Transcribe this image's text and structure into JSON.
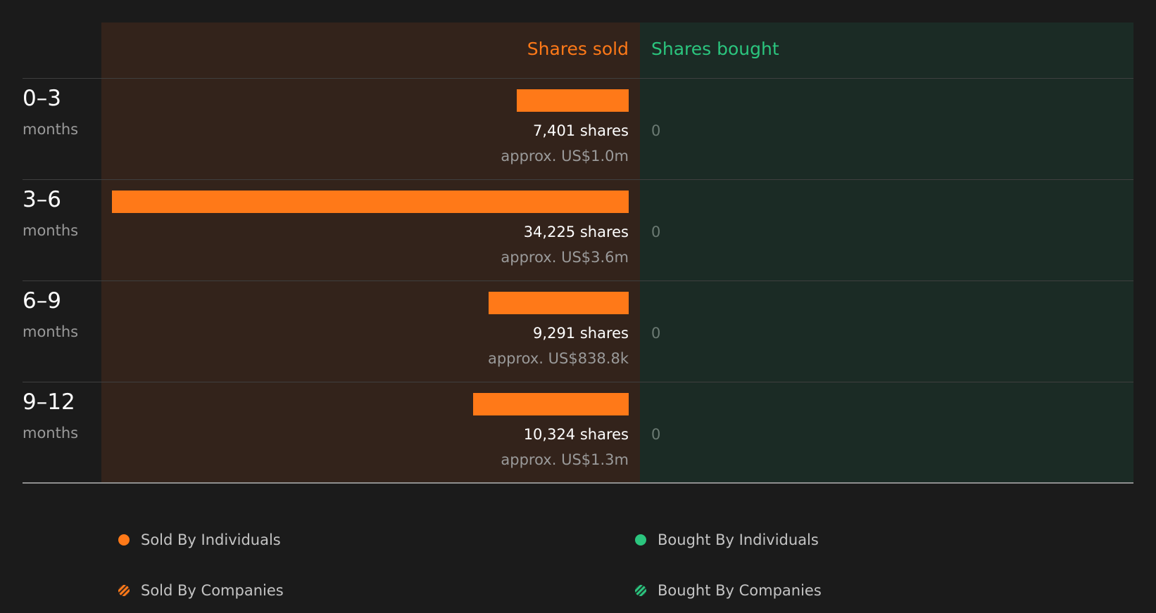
{
  "chart_data": {
    "type": "bar",
    "columns": {
      "sold": "Shares sold",
      "bought": "Shares bought"
    },
    "categories": [
      {
        "label": "0–3",
        "unit": "months"
      },
      {
        "label": "3–6",
        "unit": "months"
      },
      {
        "label": "6–9",
        "unit": "months"
      },
      {
        "label": "9–12",
        "unit": "months"
      }
    ],
    "series": [
      {
        "name": "Shares sold",
        "values": [
          7401,
          34225,
          9291,
          10324
        ],
        "value_labels": [
          "7,401 shares",
          "34,225 shares",
          "9,291 shares",
          "10,324 shares"
        ],
        "usd_labels": [
          "approx. US$1.0m",
          "approx. US$3.6m",
          "approx. US$838.8k",
          "approx. US$1.3m"
        ]
      },
      {
        "name": "Shares bought",
        "values": [
          0,
          0,
          0,
          0
        ],
        "value_labels": [
          "0",
          "0",
          "0",
          "0"
        ]
      }
    ],
    "xlim": [
      0,
      34225
    ],
    "legend": {
      "placement": "bottom",
      "items": [
        {
          "label": "Sold By Individuals",
          "icon": "orange-dot-icon"
        },
        {
          "label": "Bought By Individuals",
          "icon": "green-dot-icon"
        },
        {
          "label": "Sold By Companies",
          "icon": "orange-hatched-dot-icon"
        },
        {
          "label": "Bought By Companies",
          "icon": "green-hatched-dot-icon"
        }
      ]
    },
    "colors": {
      "sold": "#ff7918",
      "bought": "#2bc57e",
      "background": "#1b1b1b",
      "sold_panel": "#33231b",
      "bought_panel": "#1b2b25"
    }
  }
}
